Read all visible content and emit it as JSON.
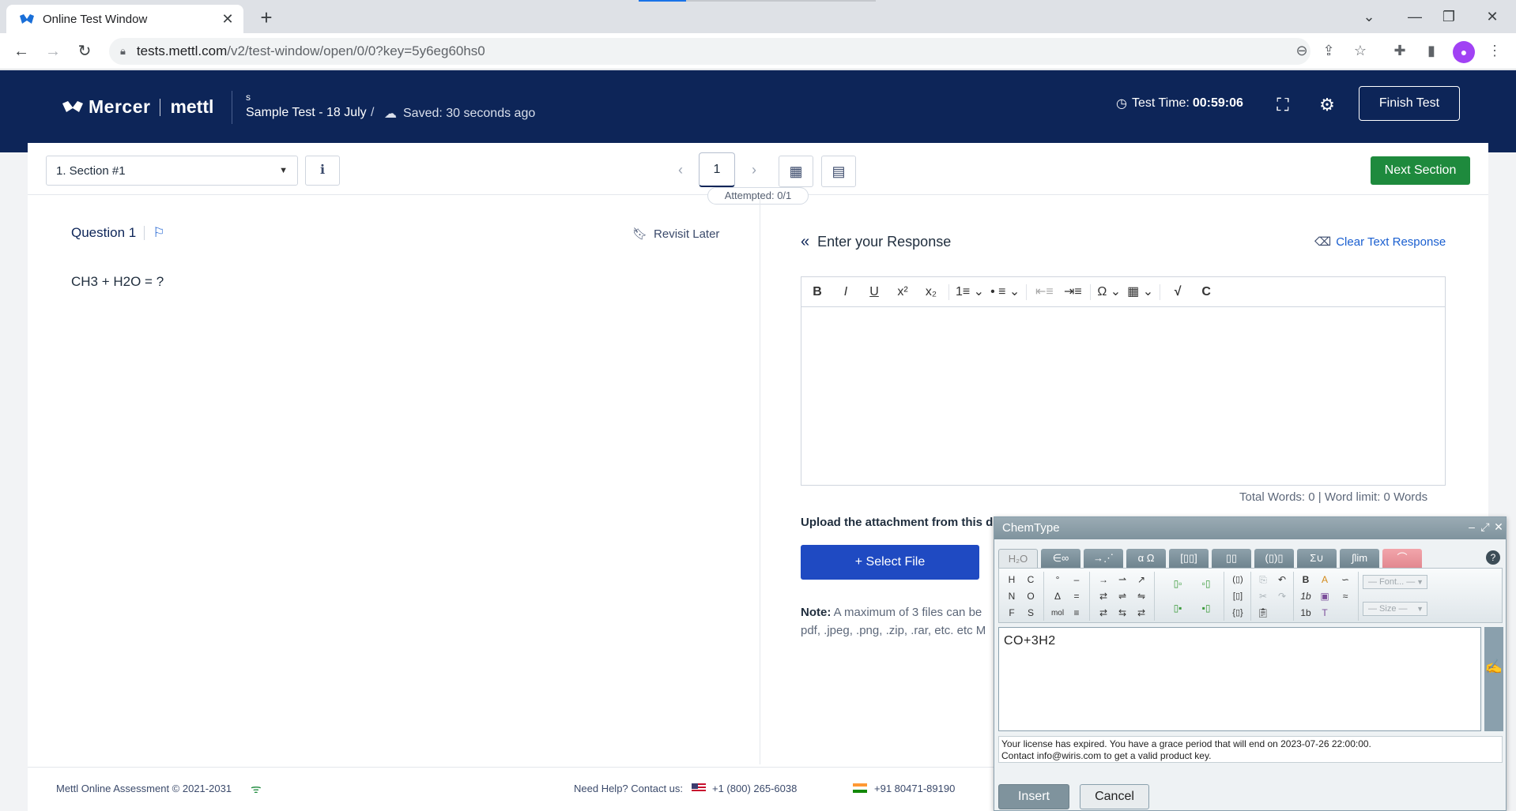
{
  "browser": {
    "tab_title": "Online Test Window",
    "url_host": "tests.mettl.com",
    "url_path": "/v2/test-window/open/0/0?key=5y6eg60hs0"
  },
  "header": {
    "brand_mercer": "Mercer",
    "brand_mettl": "mettl",
    "user_initial": "s",
    "test_name": "Sample Test - 18 July",
    "crumb_separator": "/",
    "save_status": "Saved: 30 seconds ago",
    "timer_label": "Test Time:",
    "timer_value": "00:59:06",
    "finish_label": "Finish Test"
  },
  "section_bar": {
    "section_selected": "1. Section #1",
    "current_page": "1",
    "attempted": "Attempted: 0/1",
    "next_section_label": "Next Section"
  },
  "question": {
    "title": "Question 1",
    "revisit_label": "Revisit Later",
    "text": "CH3 + H2O = ?"
  },
  "response": {
    "title": "Enter your Response",
    "clear_label": "Clear Text Response",
    "word_count": "Total Words: 0  |  Word limit: 0 Words",
    "upload_label": "Upload the attachment from this d",
    "select_file_label": "Select File",
    "note_label": "Note:",
    "note_text": "A maximum of 3 files can be pdf, .jpeg, .png, .zip, .rar, etc. etc M"
  },
  "editor_toolbar": [
    "B",
    "I",
    "U",
    "x²",
    "x₂",
    "1≡ ⌄",
    "• ≡ ⌄",
    "⇤≡",
    "⇥≡",
    "Ω ⌄",
    "▦ ⌄",
    "√",
    "C"
  ],
  "chemtype": {
    "title": "ChemType",
    "tabs": [
      "H₂O",
      "∈∞",
      "→⋰",
      "α Ω",
      "[▯▯]",
      "▯▯",
      "(▯)▯",
      "Σ∪",
      "∫lim",
      "⌒"
    ],
    "palette_elements": [
      "H",
      "C",
      "N",
      "O",
      "F",
      "S"
    ],
    "palette_symbols": [
      "°",
      "–",
      "Δ",
      "=",
      "mol",
      "≡"
    ],
    "palette_arrows": [
      "→",
      "⇀",
      "↗",
      "⇄",
      "⇌",
      "⇋",
      "⇄",
      "⇆",
      "⇄"
    ],
    "font_placeholder": "— Font... —",
    "size_placeholder": "— Size —",
    "input_text": "CO+3H2",
    "license_line1": "Your license has expired. You have a grace period that will end on 2023-07-26 22:00:00.",
    "license_line2": "Contact info@wiris.com to get a valid product key.",
    "insert_label": "Insert",
    "cancel_label": "Cancel",
    "help_label": "?"
  },
  "footer": {
    "copyright": "Mettl Online Assessment © 2021-2031",
    "help_text": "Need Help? Contact us:",
    "phone_us": "+1 (800) 265-6038",
    "phone_in": "+91 80471-89190"
  },
  "colors": {
    "header_bg": "#0d2558",
    "next_section_bg": "#1e8a3d",
    "select_file_bg": "#1f4ac2",
    "link_blue": "#1a5fd0"
  }
}
